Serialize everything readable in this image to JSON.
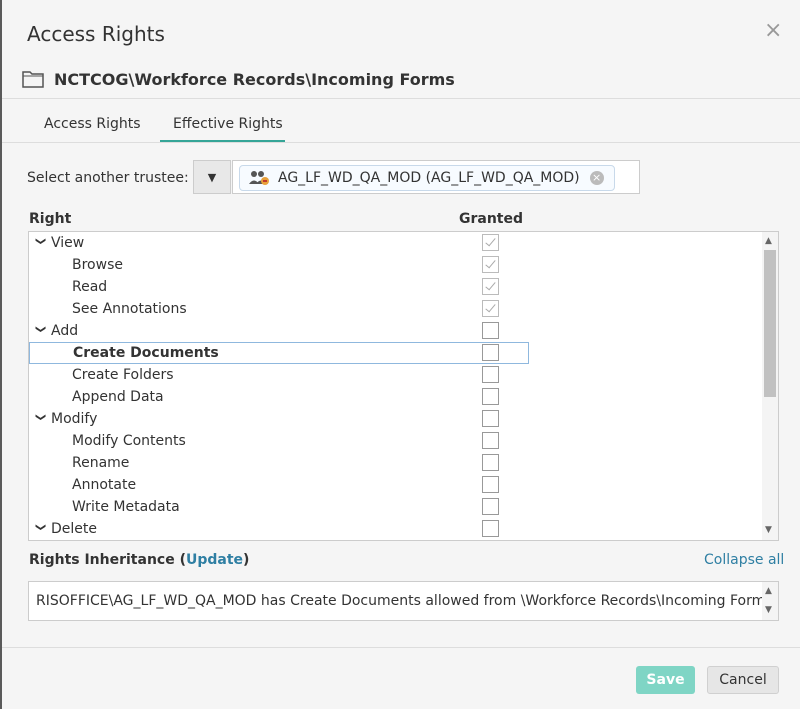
{
  "dialog": {
    "title": "Access Rights",
    "close_glyph": "×"
  },
  "path": {
    "icon": "folder-icon",
    "text": "NCTCOG\\Workforce Records\\Incoming Forms"
  },
  "tabs": [
    {
      "label": "Access Rights",
      "active": false
    },
    {
      "label": "Effective Rights",
      "active": true
    }
  ],
  "trustee": {
    "label": "Select another trustee:",
    "value": "AG_LF_WD_QA_MOD (AG_LF_WD_QA_MOD)",
    "icon": "group-icon"
  },
  "rights_table": {
    "col_right": "Right",
    "col_granted": "Granted",
    "rows": [
      {
        "label": "View",
        "level": 0,
        "granted": true,
        "expanded": true
      },
      {
        "label": "Browse",
        "level": 1,
        "granted": true
      },
      {
        "label": "Read",
        "level": 1,
        "granted": true
      },
      {
        "label": "See Annotations",
        "level": 1,
        "granted": true
      },
      {
        "label": "Add",
        "level": 0,
        "granted": false,
        "expanded": true
      },
      {
        "label": "Create Documents",
        "level": 1,
        "granted": false,
        "selected": true
      },
      {
        "label": "Create Folders",
        "level": 1,
        "granted": false
      },
      {
        "label": "Append Data",
        "level": 1,
        "granted": false
      },
      {
        "label": "Modify",
        "level": 0,
        "granted": false,
        "expanded": true
      },
      {
        "label": "Modify Contents",
        "level": 1,
        "granted": false
      },
      {
        "label": "Rename",
        "level": 1,
        "granted": false
      },
      {
        "label": "Annotate",
        "level": 1,
        "granted": false
      },
      {
        "label": "Write Metadata",
        "level": 1,
        "granted": false
      },
      {
        "label": "Delete",
        "level": 0,
        "granted": false,
        "expanded": true
      }
    ]
  },
  "inheritance": {
    "label": "Rights Inheritance",
    "open_paren": "(",
    "link": "Update",
    "close_paren": ")",
    "collapse_all": "Collapse all",
    "text": "RISOFFICE\\AG_LF_WD_QA_MOD has Create Documents allowed from \\Workforce Records\\Incoming Forms"
  },
  "buttons": {
    "save": "Save",
    "cancel": "Cancel"
  },
  "colors": {
    "accent": "#35a597",
    "link": "#2f7fa3",
    "save_disabled": "#7fd5c5"
  }
}
